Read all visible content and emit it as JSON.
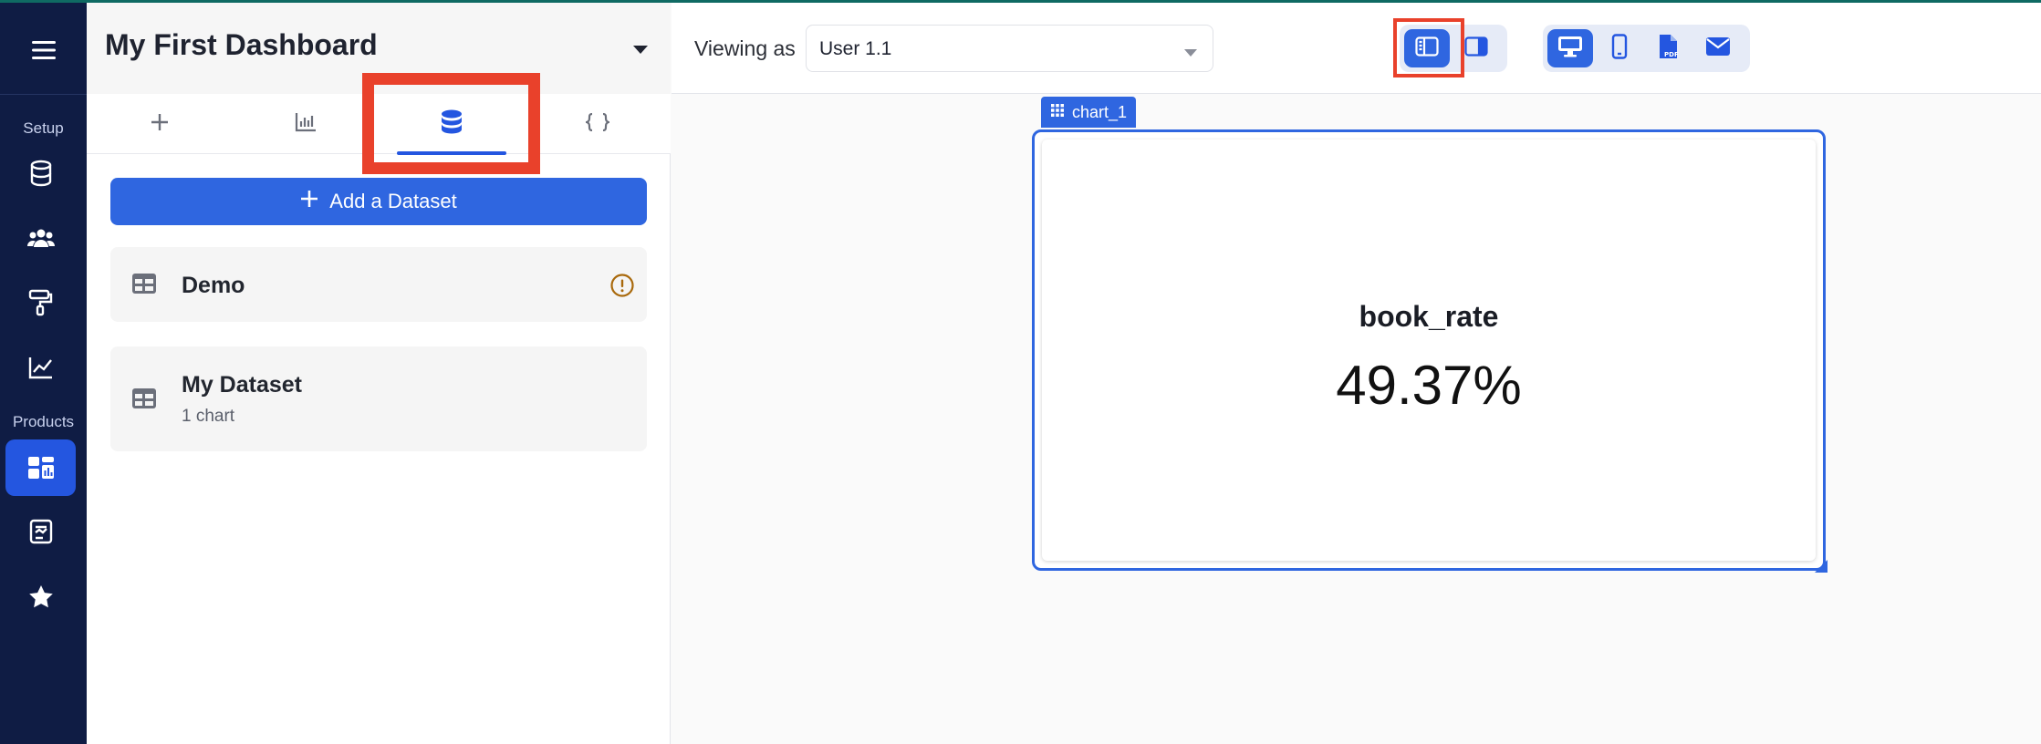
{
  "rail": {
    "sections": {
      "setup": "Setup",
      "products": "Products"
    },
    "items": [
      {
        "icon": "database-icon"
      },
      {
        "icon": "users-icon"
      },
      {
        "icon": "paint-roller-icon"
      },
      {
        "icon": "line-chart-icon"
      },
      {
        "icon": "dashboard-icon",
        "active": true
      },
      {
        "icon": "report-icon"
      },
      {
        "icon": "star-icon"
      }
    ]
  },
  "panel": {
    "title": "My First Dashboard",
    "tabs": [
      {
        "icon": "plus-icon"
      },
      {
        "icon": "bar-chart-icon"
      },
      {
        "icon": "database-icon",
        "active": true
      },
      {
        "icon": "braces-icon"
      }
    ],
    "add_dataset_label": "Add a Dataset",
    "datasets": [
      {
        "name": "Demo",
        "sub": "",
        "warning": true
      },
      {
        "name": "My Dataset",
        "sub": "1 chart",
        "warning": false
      }
    ]
  },
  "topbar": {
    "viewing_as_label": "Viewing as",
    "viewing_as_value": "User 1.1",
    "layout_toggle": [
      {
        "icon": "sidebar-left-icon",
        "active": true
      },
      {
        "icon": "sidebar-right-icon",
        "active": false
      }
    ],
    "device_toggle": [
      {
        "icon": "desktop-icon",
        "active": true
      },
      {
        "icon": "mobile-icon",
        "active": false
      },
      {
        "icon": "pdf-icon",
        "active": false
      },
      {
        "icon": "email-icon",
        "active": false
      }
    ]
  },
  "chart": {
    "tag": "chart_1",
    "metric_label": "book_rate",
    "metric_value": "49.37%"
  },
  "colors": {
    "rail": "#0f1c44",
    "accent": "#2f66e0",
    "highlight": "#e9412b",
    "warning": "#a9690c"
  }
}
